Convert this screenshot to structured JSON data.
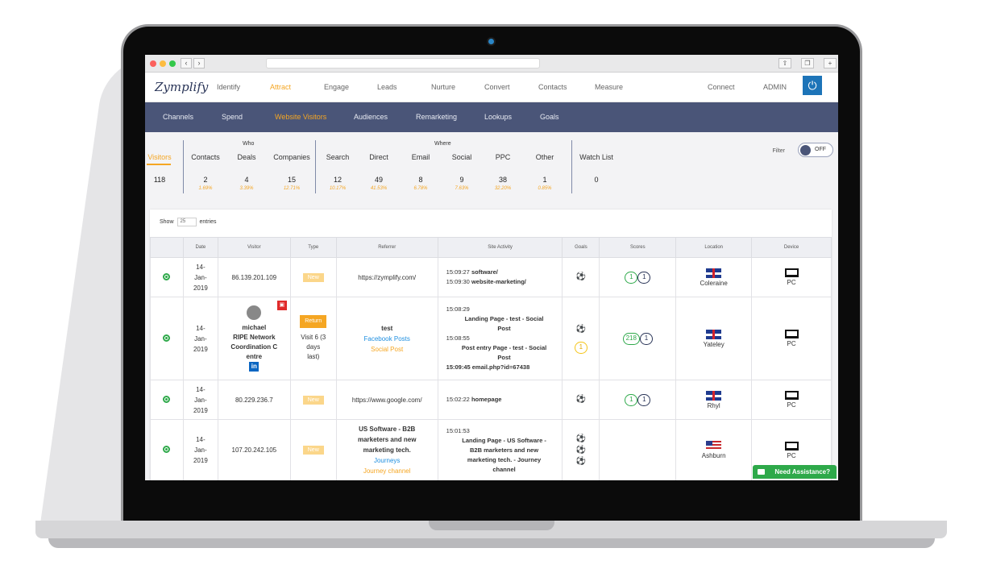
{
  "app": {
    "logo": "Zymplify",
    "main_nav": [
      "Identify",
      "Attract",
      "Engage",
      "Leads",
      "Nurture",
      "Convert",
      "Contacts",
      "Measure"
    ],
    "active_main": "Attract",
    "right_nav": [
      "Connect",
      "ADMIN"
    ],
    "sub_nav": [
      "Channels",
      "Spend",
      "Website Visitors",
      "Audiences",
      "Remarketing",
      "Lookups",
      "Goals"
    ],
    "active_sub": "Website Visitors"
  },
  "stats": {
    "group_who": "Who",
    "group_where": "Where",
    "items": [
      {
        "label": "Visitors",
        "value": "118",
        "pct": ""
      },
      {
        "label": "Contacts",
        "value": "2",
        "pct": "1.69%"
      },
      {
        "label": "Deals",
        "value": "4",
        "pct": "3.39%"
      },
      {
        "label": "Companies",
        "value": "15",
        "pct": "12.71%"
      },
      {
        "label": "Search",
        "value": "12",
        "pct": "10.17%"
      },
      {
        "label": "Direct",
        "value": "49",
        "pct": "41.53%"
      },
      {
        "label": "Email",
        "value": "8",
        "pct": "6.78%"
      },
      {
        "label": "Social",
        "value": "9",
        "pct": "7.63%"
      },
      {
        "label": "PPC",
        "value": "38",
        "pct": "32.20%"
      },
      {
        "label": "Other",
        "value": "1",
        "pct": "0.85%"
      },
      {
        "label": "Watch List",
        "value": "0",
        "pct": ""
      }
    ],
    "filter_label": "Filter",
    "toggle_text": "OFF"
  },
  "table": {
    "show_label": "Show",
    "show_value": "25",
    "entries_label": "entries",
    "headers": [
      "",
      "Date",
      "Visitor",
      "Type",
      "Referrer",
      "Site Activity",
      "Goals",
      "Scores",
      "Location",
      "Device"
    ],
    "rows": [
      {
        "date": [
          "14-",
          "Jan-",
          "2019"
        ],
        "visitor": "86.139.201.109",
        "type": "New",
        "referrer": "https://zymplify.com/",
        "activity": [
          [
            "15:09:27",
            "software/"
          ],
          [
            "15:09:30",
            "website-marketing/"
          ]
        ],
        "scores": [
          "1",
          "1"
        ],
        "location": "Coleraine",
        "device": "PC"
      },
      {
        "date": [
          "14-",
          "Jan-",
          "2019"
        ],
        "visitor_name": "michael",
        "visitor_org": [
          "RIPE Network",
          "Coordination C",
          "entre"
        ],
        "type": "Return",
        "type_note": [
          "Visit 6 (3",
          "days",
          "last)"
        ],
        "referrer_lines": [
          "test",
          "Facebook Posts",
          "Social Post"
        ],
        "activity_lines": [
          "15:08:29",
          "Landing Page - test - Social",
          "Post",
          "15:08:55",
          "Post entry Page - test - Social",
          "Post",
          "15:09:45 email.php?id=67438"
        ],
        "goal_badge": "1",
        "scores": [
          "218",
          "1"
        ],
        "location": "Yateley",
        "device": "PC"
      },
      {
        "date": [
          "14-",
          "Jan-",
          "2019"
        ],
        "visitor": "80.229.236.7",
        "type": "New",
        "referrer": "https://www.google.com/",
        "activity": [
          [
            "15:02:22",
            "homepage"
          ]
        ],
        "scores": [
          "1",
          "1"
        ],
        "location": "Rhyl",
        "device": "PC"
      },
      {
        "date": [
          "14-",
          "Jan-",
          "2019"
        ],
        "visitor": "107.20.242.105",
        "type": "New",
        "referrer_lines": [
          "US Software - B2B",
          "marketers and new",
          "marketing tech.",
          "Journeys",
          "Journey channel"
        ],
        "activity_lines": [
          "15:01:53",
          "Landing Page - US Software -",
          "B2B marketers and new",
          "marketing tech. - Journey",
          "channel"
        ],
        "location": "Ashburn",
        "device": "PC"
      }
    ]
  },
  "assist": {
    "label": "Need Assistance?"
  },
  "colors": {
    "accent": "#f5a623",
    "nav_bg": "#4a5578",
    "green": "#2ea94a",
    "power": "#1d74b8"
  }
}
